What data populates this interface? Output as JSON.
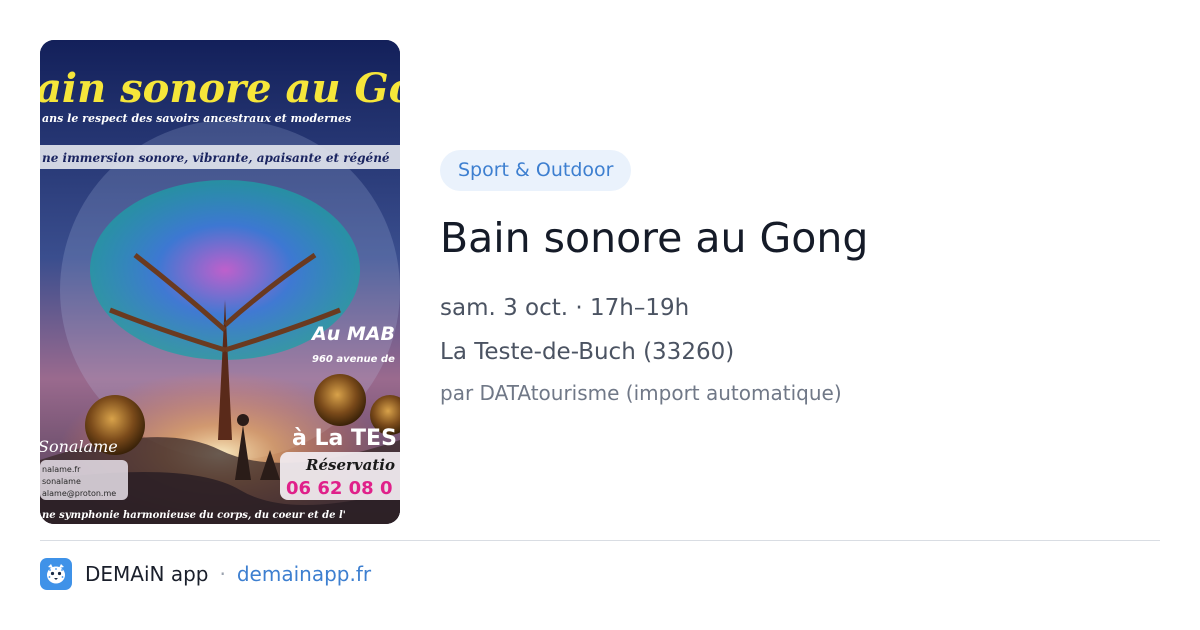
{
  "poster": {
    "headline": "ain sonore au Gon",
    "subline": "ans le respect des savoirs ancestraux et modernes",
    "banner": "ne immersion sonore, vibrante, apaisante et régéné",
    "venue": "Au MAB",
    "address": "960 avenue de",
    "town": "à La TES",
    "brand": "Sonalame",
    "contact_lines": [
      "nalame.fr",
      "sonalame",
      "alame@proton.me"
    ],
    "booking_label": "Réservatio",
    "phone": "06 62 08 0",
    "bottom_text": "ne symphonie harmonieuse du corps, du coeur et de l'"
  },
  "event": {
    "category": "Sport & Outdoor",
    "title": "Bain sonore au Gong",
    "datetime": "sam. 3 oct. · 17h–19h",
    "location": "La Teste-de-Buch (33260)",
    "source": "par DATAtourisme (import automatique)"
  },
  "footer": {
    "app_name": "DEMAiN app",
    "separator": "·",
    "domain": "demainapp.fr"
  },
  "colors": {
    "accent": "#3d7fd0",
    "badge_bg": "#eaf2fc",
    "title": "#151b28",
    "meta": "#4b5362",
    "muted": "#707887"
  },
  "icons": {
    "app_logo": "leopard-face-icon"
  }
}
